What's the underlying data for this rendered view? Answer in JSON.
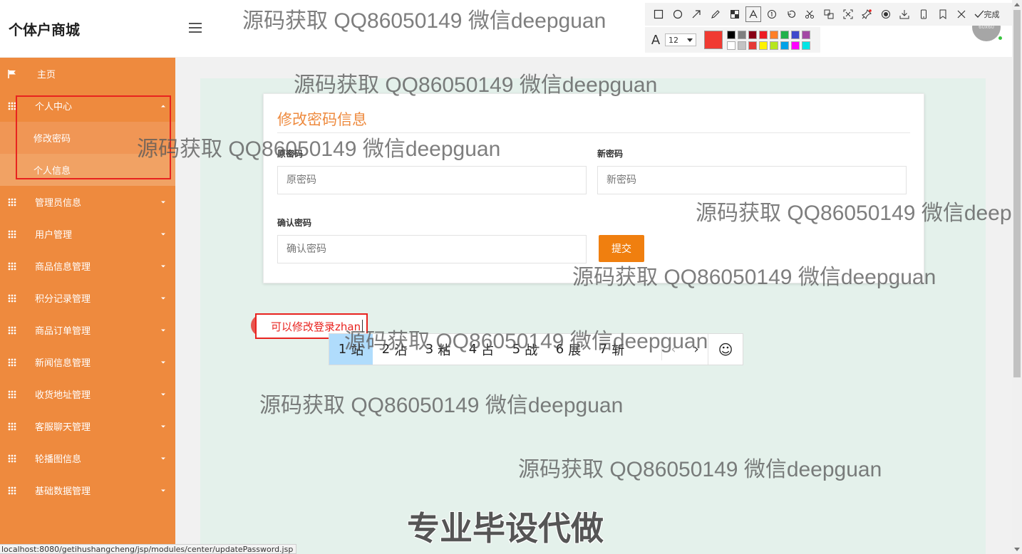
{
  "app": {
    "brand": "个体户商城"
  },
  "sidebar": {
    "items": [
      {
        "label": "主页",
        "icon": "flag-icon"
      },
      {
        "label": "个人中心",
        "icon": "grid-icon",
        "expanded": true,
        "children": [
          {
            "label": "修改密码"
          },
          {
            "label": "个人信息"
          }
        ]
      },
      {
        "label": "管理员信息",
        "icon": "grid-icon"
      },
      {
        "label": "用户管理",
        "icon": "grid-icon"
      },
      {
        "label": "商品信息管理",
        "icon": "grid-icon"
      },
      {
        "label": "积分记录管理",
        "icon": "grid-icon"
      },
      {
        "label": "商品订单管理",
        "icon": "grid-icon"
      },
      {
        "label": "新闻信息管理",
        "icon": "grid-icon"
      },
      {
        "label": "收货地址管理",
        "icon": "grid-icon"
      },
      {
        "label": "客服聊天管理",
        "icon": "grid-icon"
      },
      {
        "label": "轮播图信息",
        "icon": "grid-icon"
      },
      {
        "label": "基础数据管理",
        "icon": "grid-icon"
      }
    ]
  },
  "header": {
    "avatar_text": "60x60"
  },
  "snip_toolbar": {
    "done_label": "完成",
    "font_size": "12",
    "current_color": "#f03a32",
    "swatches": [
      "#000000",
      "#7f7f7f",
      "#880015",
      "#ed1c24",
      "#ff7f27",
      "#22b14c",
      "#3f48cc",
      "#a349a4",
      "#ffffff",
      "#c3c3c3",
      "#e53935",
      "#fff200",
      "#b5e61d",
      "#00a2e8",
      "#ff00ff",
      "#00e5e5"
    ]
  },
  "form": {
    "title": "修改密码信息",
    "old_password": {
      "label": "原密码",
      "placeholder": "原密码"
    },
    "new_password": {
      "label": "新密码",
      "placeholder": "新密码"
    },
    "confirm_password": {
      "label": "确认密码",
      "placeholder": "确认密码"
    },
    "submit_label": "提交"
  },
  "ime": {
    "input_text": "可以修改登录zhan",
    "candidates": [
      {
        "num": "1",
        "text": "站"
      },
      {
        "num": "2",
        "text": "沾"
      },
      {
        "num": "3",
        "text": "粘"
      },
      {
        "num": "4",
        "text": "占"
      },
      {
        "num": "5",
        "text": "战"
      },
      {
        "num": "6",
        "text": "展"
      },
      {
        "num": "7",
        "text": "斩"
      }
    ],
    "prev_label": "‹",
    "next_label": "›",
    "emoji_label": "☺"
  },
  "watermarks": {
    "text": "源码获取 QQ86050149 微信deepguan",
    "bold_text": "专业毕设代做"
  },
  "status_url": "localhost:8080/getihushangcheng/jsp/modules/center/updatePassword.jsp",
  "colors": {
    "accent": "#ee8a3e",
    "button": "#f07f0f",
    "content_bg": "#e4f1eb"
  }
}
